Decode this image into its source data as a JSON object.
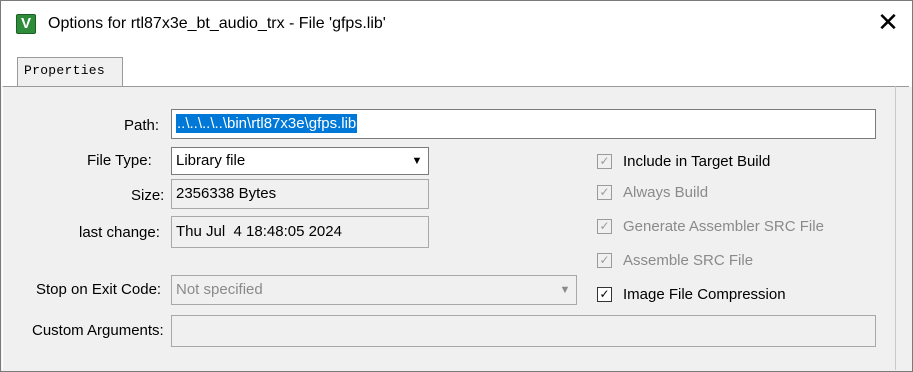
{
  "window": {
    "app_icon_glyph": "V",
    "title": "Options for rtl87x3e_bt_audio_trx - File 'gfps.lib'",
    "close_glyph": "✕"
  },
  "tabs": [
    {
      "label": "Properties",
      "selected": true
    }
  ],
  "form": {
    "path_label": "Path:",
    "path_value": "..\\..\\..\\..\\bin\\rtl87x3e\\gfps.lib",
    "file_type_label": "File Type:",
    "file_type_value": "Library file",
    "size_label": "Size:",
    "size_value": "2356338 Bytes",
    "last_change_label": "last change:",
    "last_change_value": "Thu Jul  4 18:48:05 2024",
    "stop_label": "Stop on Exit Code:",
    "stop_value": "Not specified",
    "custom_label": "Custom Arguments:",
    "custom_value": ""
  },
  "options": [
    {
      "label": "Include in Target Build",
      "checked": true,
      "enabled": true
    },
    {
      "label": "Always Build",
      "checked": true,
      "enabled": false
    },
    {
      "label": "Generate Assembler SRC File",
      "checked": true,
      "enabled": false
    },
    {
      "label": "Assemble SRC File",
      "checked": true,
      "enabled": false
    },
    {
      "label": "Image File Compression",
      "checked": true,
      "enabled": true
    }
  ],
  "glyphs": {
    "check": "✓",
    "dropdown": "▼"
  },
  "colors": {
    "selection": "#0078d7",
    "app_icon": "#2e8b3a"
  }
}
